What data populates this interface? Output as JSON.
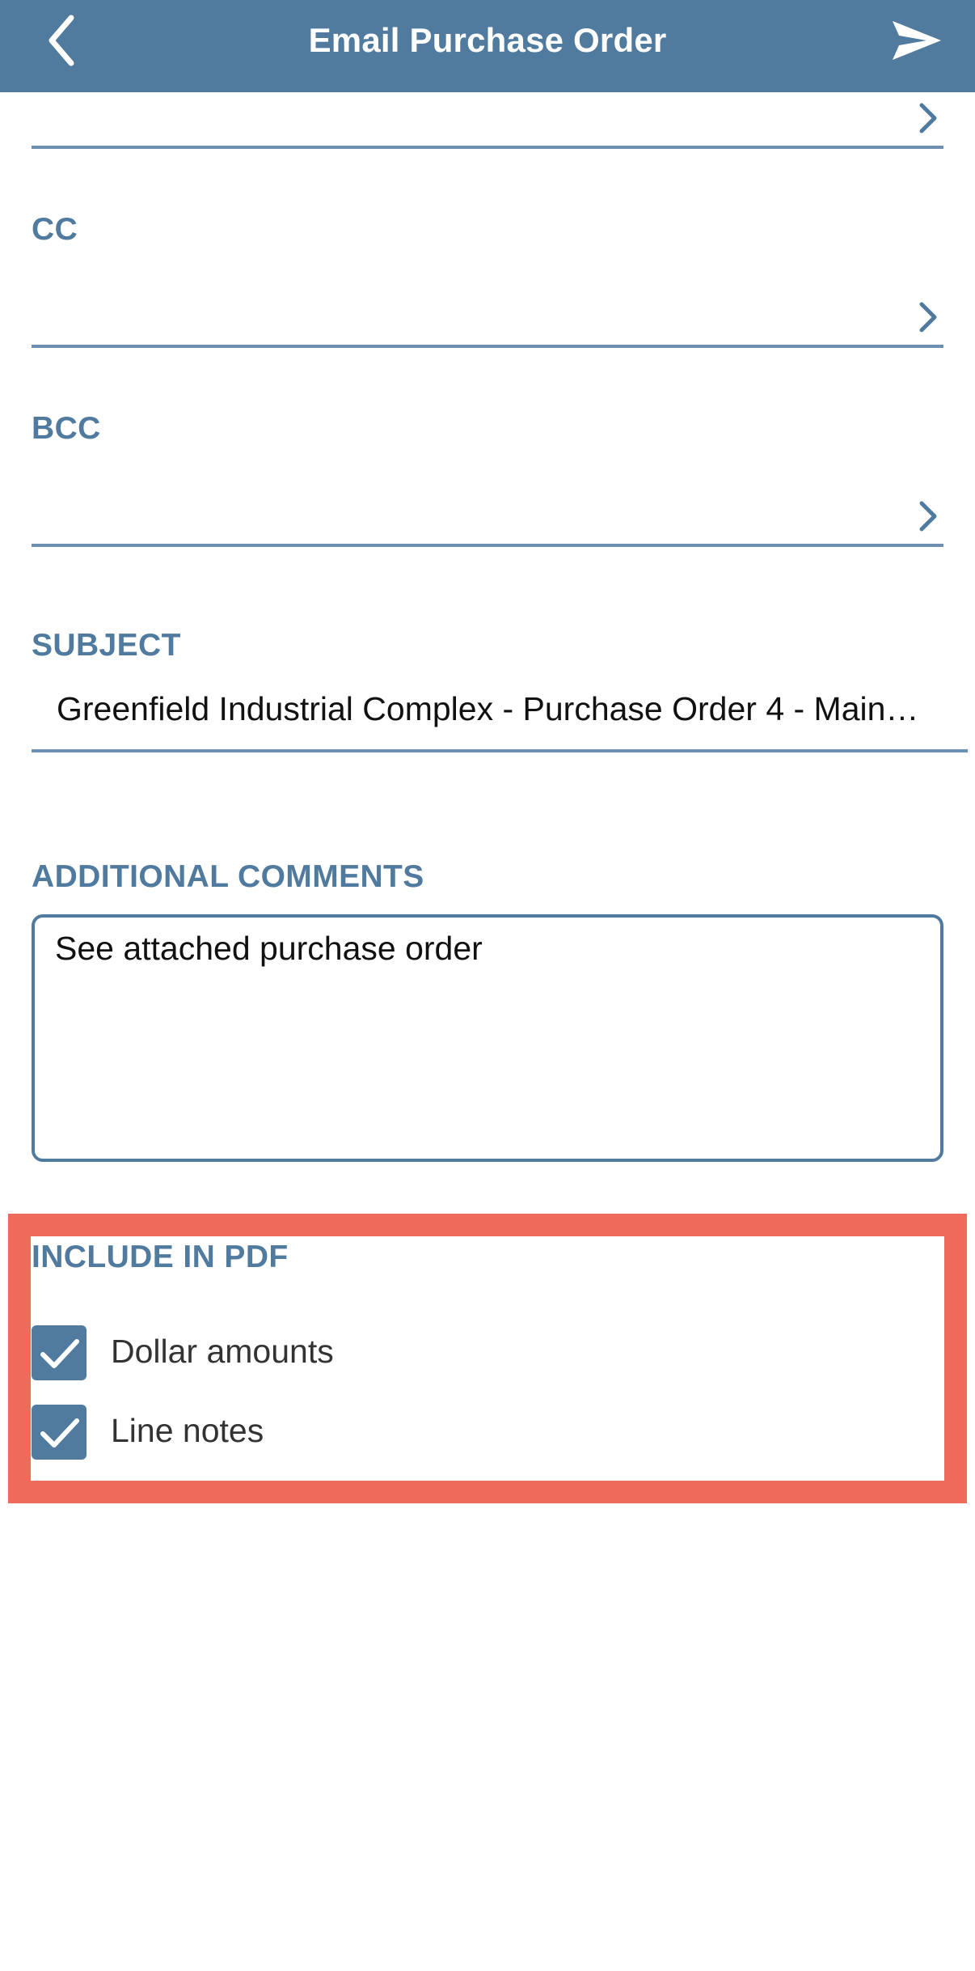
{
  "header": {
    "title": "Email Purchase Order",
    "back_icon": "chevron-left-icon",
    "send_icon": "send-icon"
  },
  "form": {
    "to_chevron_icon": "chevron-right-icon",
    "cc": {
      "label": "CC",
      "value": ""
    },
    "bcc": {
      "label": "BCC",
      "value": ""
    },
    "subject": {
      "label": "SUBJECT",
      "value": "Greenfield Industrial Complex - Purchase Order 4 - Main…"
    },
    "comments": {
      "label": "ADDITIONAL COMMENTS",
      "value": "See attached purchase order"
    },
    "include_in_pdf": {
      "label": "INCLUDE IN PDF",
      "options": [
        {
          "label": "Dollar amounts",
          "checked": true
        },
        {
          "label": "Line notes",
          "checked": true
        }
      ]
    }
  },
  "colors": {
    "nav_bar": "#517a9f",
    "label": "#517a9f",
    "highlight": "#ee6a5a"
  }
}
